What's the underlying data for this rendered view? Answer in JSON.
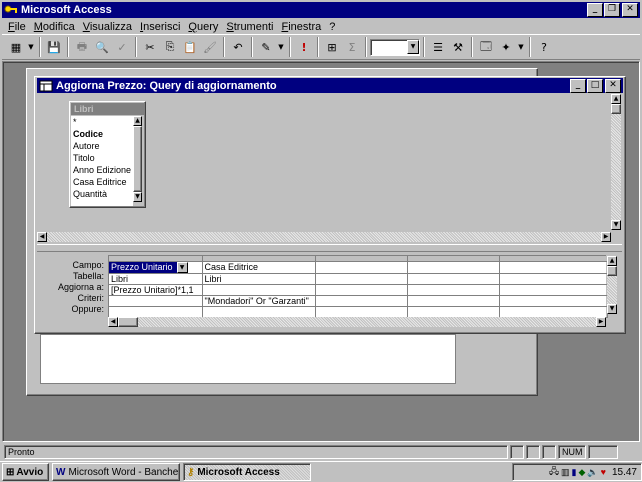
{
  "app": {
    "title": "Microsoft Access"
  },
  "menu": [
    "File",
    "Modifica",
    "Visualizza",
    "Inserisci",
    "Query",
    "Strumenti",
    "Finestra",
    "?"
  ],
  "query_window": {
    "title": "Aggiorna Prezzo: Query di aggiornamento"
  },
  "field_list": {
    "title": "Libri",
    "fields": [
      "*",
      "Codice",
      "Autore",
      "Titolo",
      "Anno Edizione",
      "Casa Editrice",
      "Quantità"
    ]
  },
  "grid": {
    "row_labels": [
      "Campo:",
      "Tabella:",
      "Aggiorna a:",
      "Criteri:",
      "Oppure:"
    ],
    "columns": [
      [
        "Prezzo Unitario",
        "Libri",
        "[Prezzo Unitario]*1,1",
        "",
        ""
      ],
      [
        "Casa Editrice",
        "Libri",
        "",
        "\"Mondadori\" Or \"Garzanti\"",
        ""
      ],
      [
        "",
        "",
        "",
        "",
        ""
      ],
      [
        "",
        "",
        "",
        "",
        ""
      ],
      [
        "",
        "",
        "",
        "",
        ""
      ]
    ]
  },
  "status": {
    "text": "Pronto",
    "num": "NUM"
  },
  "taskbar": {
    "start": "Avvio",
    "tasks": [
      "Microsoft Word - Banche d...",
      "Microsoft Access"
    ],
    "clock": "15.47"
  }
}
